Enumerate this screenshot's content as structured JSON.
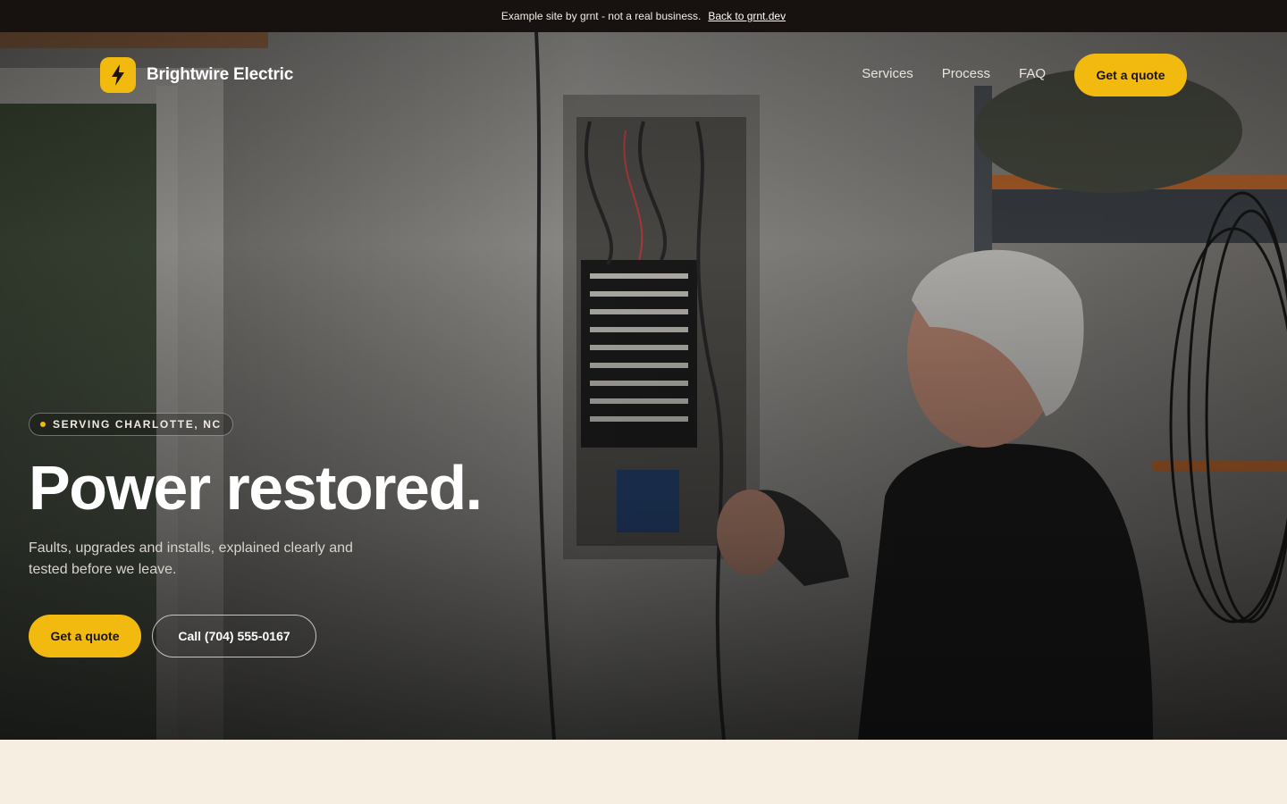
{
  "topbar": {
    "notice": "Example site by grnt - not a real business.",
    "back_link": "Back to grnt.dev"
  },
  "nav": {
    "brand_name": "Brightwire Electric",
    "links": [
      "Services",
      "Process",
      "FAQ"
    ],
    "cta": "Get a quote"
  },
  "hero": {
    "badge": "SERVING CHARLOTTE, NC",
    "headline": "Power restored.",
    "subtitle": "Faults, upgrades and installs, explained clearly and tested before we leave.",
    "primary_cta": "Get a quote",
    "secondary_cta": "Call (704) 555-0167"
  },
  "colors": {
    "accent": "#f2b90f",
    "topbar_bg": "#17120f",
    "page_bg": "#f6efe1"
  },
  "icons": {
    "logo": "lightning-bolt-icon",
    "badge": "dot-icon"
  }
}
